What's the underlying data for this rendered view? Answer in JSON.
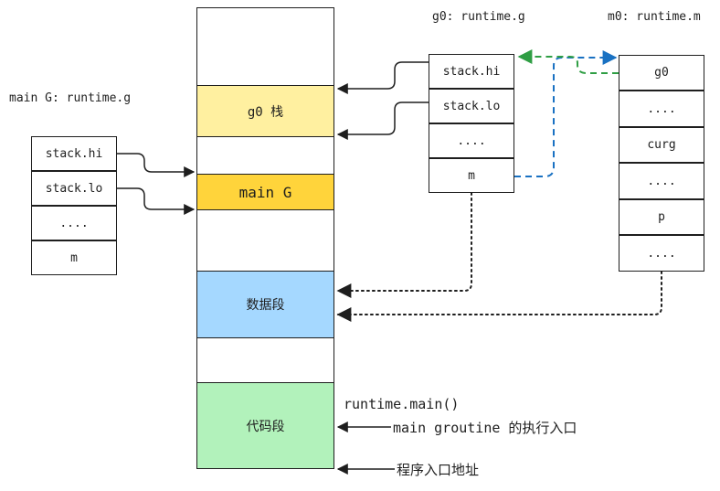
{
  "memory": {
    "g0_stack": "g0 栈",
    "main_g": "main G",
    "data_segment": "数据段",
    "code_segment": "代码段"
  },
  "main_g_struct": {
    "title": "main G: runtime.g",
    "fields": [
      "stack.hi",
      "stack.lo",
      "....",
      "m"
    ]
  },
  "g0_struct": {
    "title": "g0: runtime.g",
    "fields": [
      "stack.hi",
      "stack.lo",
      "....",
      "m"
    ]
  },
  "m0_struct": {
    "title": "m0: runtime.m",
    "fields": [
      "g0",
      "....",
      "curg",
      "....",
      "p",
      "...."
    ]
  },
  "annotations": {
    "runtime_main": "runtime.main()",
    "main_goroutine": "main groutine 的执行入口",
    "program_entry": "程序入口地址"
  },
  "colors": {
    "g0_stack_fill": "#fff0a0",
    "main_g_fill": "#ffd43b",
    "data_fill": "#a5d8ff",
    "code_fill": "#b2f2bb",
    "blue_arrow": "#1971c2",
    "green_arrow": "#2f9e44"
  }
}
